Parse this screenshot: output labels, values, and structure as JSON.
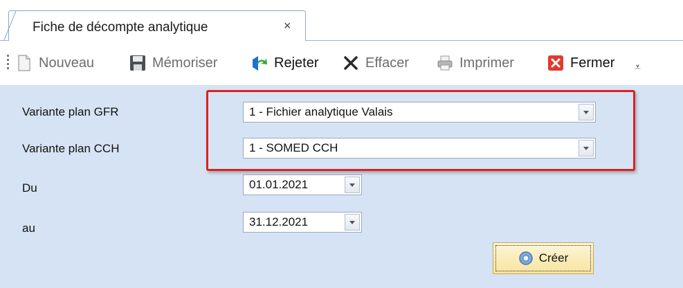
{
  "tab": {
    "title": "Fiche de décompte analytique",
    "close": "×"
  },
  "toolbar": {
    "nouveau": "Nouveau",
    "memoriser": "Mémoriser",
    "rejeter": "Rejeter",
    "effacer": "Effacer",
    "imprimer": "Imprimer",
    "fermer": "Fermer",
    "overflow": "⩡"
  },
  "form": {
    "gfr_label": "Variante plan GFR",
    "gfr_value": "1 - Fichier analytique Valais",
    "cch_label": "Variante plan CCH",
    "cch_value": "1 - SOMED CCH",
    "du_label": "Du",
    "du_value": "01.01.2021",
    "au_label": "au",
    "au_value": "31.12.2021",
    "create_label": "Créer"
  },
  "colors": {
    "panel_bg": "#d6e3f4",
    "highlight": "#e02020",
    "create_bg": "#f7e49e"
  }
}
